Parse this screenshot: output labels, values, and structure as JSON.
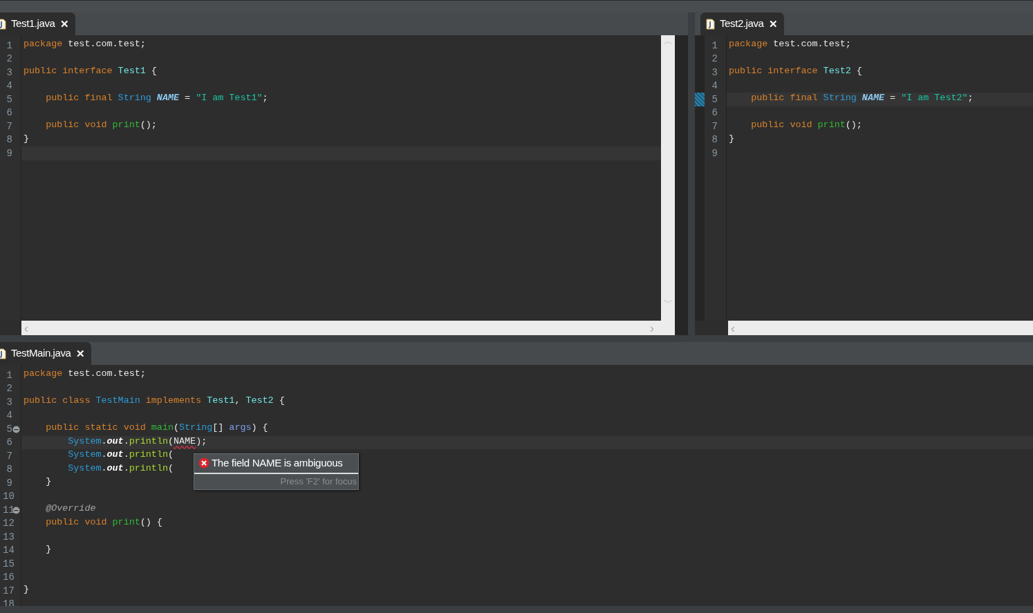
{
  "editors": [
    {
      "tab": {
        "title": "Test1.java",
        "selected": true,
        "close": "✕"
      },
      "scroll": {
        "up": "︿",
        "down": "﹀",
        "left": "‹",
        "right": "›"
      },
      "lines": [
        {
          "number": "1",
          "current": false,
          "fold": false,
          "marked": false,
          "tokens": [
            {
              "kind": "keyword",
              "text": "package "
            },
            {
              "kind": "plain",
              "text": "test.com.test;"
            }
          ]
        },
        {
          "number": "2",
          "current": false,
          "fold": false,
          "marked": false
        },
        {
          "number": "3",
          "current": false,
          "fold": false,
          "marked": false,
          "tokens": [
            {
              "kind": "keyword",
              "text": "public interface "
            },
            {
              "kind": "interface",
              "text": "Test1"
            },
            {
              "kind": "plain",
              "text": " {"
            }
          ]
        },
        {
          "number": "4",
          "current": false,
          "fold": false,
          "marked": false
        },
        {
          "number": "5",
          "current": false,
          "fold": false,
          "marked": false,
          "tokens": [
            {
              "kind": "keyword",
              "text": "    public final "
            },
            {
              "kind": "type",
              "text": "String "
            },
            {
              "kind": "constant",
              "text": "NAME"
            },
            {
              "kind": "plain",
              "text": " = "
            },
            {
              "kind": "string",
              "text": "\"I am Test1\""
            },
            {
              "kind": "plain",
              "text": ";"
            }
          ]
        },
        {
          "number": "6",
          "current": false,
          "fold": false,
          "marked": false
        },
        {
          "number": "7",
          "current": false,
          "fold": false,
          "marked": false,
          "tokens": [
            {
              "kind": "keyword",
              "text": "    public void "
            },
            {
              "kind": "method",
              "text": "print"
            },
            {
              "kind": "plain",
              "text": "();"
            }
          ]
        },
        {
          "number": "8",
          "current": false,
          "fold": false,
          "marked": false,
          "tokens": [
            {
              "kind": "plain",
              "text": "}"
            }
          ]
        },
        {
          "number": "9",
          "current": true,
          "fold": false,
          "marked": false
        }
      ]
    },
    {
      "tab": {
        "title": "Test2.java",
        "selected": true,
        "close": "✕"
      },
      "scroll": {
        "left": "‹"
      },
      "lines": [
        {
          "number": "1",
          "current": false,
          "fold": false,
          "marked": false,
          "tokens": [
            {
              "kind": "keyword",
              "text": "package "
            },
            {
              "kind": "plain",
              "text": "test.com.test;"
            }
          ]
        },
        {
          "number": "2",
          "current": false,
          "fold": false,
          "marked": false
        },
        {
          "number": "3",
          "current": false,
          "fold": false,
          "marked": false,
          "tokens": [
            {
              "kind": "keyword",
              "text": "public interface "
            },
            {
              "kind": "interface",
              "text": "Test2"
            },
            {
              "kind": "plain",
              "text": " {"
            }
          ]
        },
        {
          "number": "4",
          "current": false,
          "fold": false,
          "marked": false
        },
        {
          "number": "5",
          "current": true,
          "fold": false,
          "marked": true,
          "tokens": [
            {
              "kind": "keyword",
              "text": "    public final "
            },
            {
              "kind": "type",
              "text": "String "
            },
            {
              "kind": "constant",
              "text": "NAME"
            },
            {
              "kind": "plain",
              "text": " = "
            },
            {
              "kind": "string",
              "text": "\"I am Test2\""
            },
            {
              "kind": "plain",
              "text": ";"
            }
          ]
        },
        {
          "number": "6",
          "current": false,
          "fold": false,
          "marked": false
        },
        {
          "number": "7",
          "current": false,
          "fold": false,
          "marked": false,
          "tokens": [
            {
              "kind": "keyword",
              "text": "    public void "
            },
            {
              "kind": "method",
              "text": "print"
            },
            {
              "kind": "plain",
              "text": "();"
            }
          ]
        },
        {
          "number": "8",
          "current": false,
          "fold": false,
          "marked": false,
          "tokens": [
            {
              "kind": "plain",
              "text": "}"
            }
          ]
        },
        {
          "number": "9",
          "current": false,
          "fold": false,
          "marked": false
        }
      ]
    },
    {
      "tab": {
        "title": "TestMain.java",
        "selected": true,
        "close": "✕"
      },
      "lines": [
        {
          "number": "1",
          "current": false,
          "fold": false,
          "marked": false,
          "tokens": [
            {
              "kind": "keyword",
              "text": "package "
            },
            {
              "kind": "plain",
              "text": "test.com.test;"
            }
          ]
        },
        {
          "number": "2",
          "current": false,
          "fold": false,
          "marked": false
        },
        {
          "number": "3",
          "current": false,
          "fold": false,
          "marked": false,
          "tokens": [
            {
              "kind": "keyword",
              "text": "public class "
            },
            {
              "kind": "class",
              "text": "TestMain"
            },
            {
              "kind": "keyword",
              "text": " implements "
            },
            {
              "kind": "interface",
              "text": "Test1"
            },
            {
              "kind": "plain",
              "text": ", "
            },
            {
              "kind": "interface",
              "text": "Test2"
            },
            {
              "kind": "plain",
              "text": " {"
            }
          ]
        },
        {
          "number": "4",
          "current": false,
          "fold": false,
          "marked": false
        },
        {
          "number": "5",
          "current": false,
          "fold": true,
          "marked": false,
          "tokens": [
            {
              "kind": "keyword",
              "text": "    public static void "
            },
            {
              "kind": "method",
              "text": "main"
            },
            {
              "kind": "plain",
              "text": "("
            },
            {
              "kind": "type",
              "text": "String"
            },
            {
              "kind": "plain",
              "text": "[] "
            },
            {
              "kind": "param",
              "text": "args"
            },
            {
              "kind": "plain",
              "text": ") {"
            }
          ]
        },
        {
          "number": "6",
          "current": true,
          "fold": false,
          "marked": false,
          "tokens": [
            {
              "kind": "class",
              "text": "        System"
            },
            {
              "kind": "plain",
              "text": "."
            },
            {
              "kind": "static",
              "text": "out"
            },
            {
              "kind": "plain",
              "text": "."
            },
            {
              "kind": "call",
              "text": "println"
            },
            {
              "kind": "plain",
              "text": "("
            },
            {
              "kind": "error",
              "text": "NAME"
            },
            {
              "kind": "plain",
              "text": ");"
            }
          ]
        },
        {
          "number": "7",
          "current": false,
          "fold": false,
          "marked": false,
          "tokens": [
            {
              "kind": "class",
              "text": "        System"
            },
            {
              "kind": "plain",
              "text": "."
            },
            {
              "kind": "static",
              "text": "out"
            },
            {
              "kind": "plain",
              "text": "."
            },
            {
              "kind": "call",
              "text": "println"
            },
            {
              "kind": "plain",
              "text": "("
            }
          ]
        },
        {
          "number": "8",
          "current": false,
          "fold": false,
          "marked": false,
          "tokens": [
            {
              "kind": "class",
              "text": "        System"
            },
            {
              "kind": "plain",
              "text": "."
            },
            {
              "kind": "static",
              "text": "out"
            },
            {
              "kind": "plain",
              "text": "."
            },
            {
              "kind": "call",
              "text": "println"
            },
            {
              "kind": "plain",
              "text": "("
            }
          ]
        },
        {
          "number": "9",
          "current": false,
          "fold": false,
          "marked": false,
          "tokens": [
            {
              "kind": "plain",
              "text": "    }"
            }
          ]
        },
        {
          "number": "10",
          "current": false,
          "fold": false,
          "marked": false
        },
        {
          "number": "11",
          "current": false,
          "fold": true,
          "marked": false,
          "tokens": [
            {
              "kind": "annotation",
              "text": "    @Override"
            }
          ]
        },
        {
          "number": "12",
          "current": false,
          "fold": false,
          "marked": false,
          "tokens": [
            {
              "kind": "keyword",
              "text": "    public void "
            },
            {
              "kind": "method",
              "text": "print"
            },
            {
              "kind": "plain",
              "text": "() {"
            }
          ]
        },
        {
          "number": "13",
          "current": false,
          "fold": false,
          "marked": false
        },
        {
          "number": "14",
          "current": false,
          "fold": false,
          "marked": false,
          "tokens": [
            {
              "kind": "plain",
              "text": "    }"
            }
          ]
        },
        {
          "number": "15",
          "current": false,
          "fold": false,
          "marked": false
        },
        {
          "number": "16",
          "current": false,
          "fold": false,
          "marked": false
        },
        {
          "number": "17",
          "current": false,
          "fold": false,
          "marked": false,
          "tokens": [
            {
              "kind": "plain",
              "text": "}"
            }
          ]
        },
        {
          "number": "18",
          "current": false,
          "fold": false,
          "marked": false
        }
      ],
      "tooltip": {
        "message": "The field NAME is ambiguous",
        "hint": "Press 'F2' for focus"
      }
    }
  ]
}
